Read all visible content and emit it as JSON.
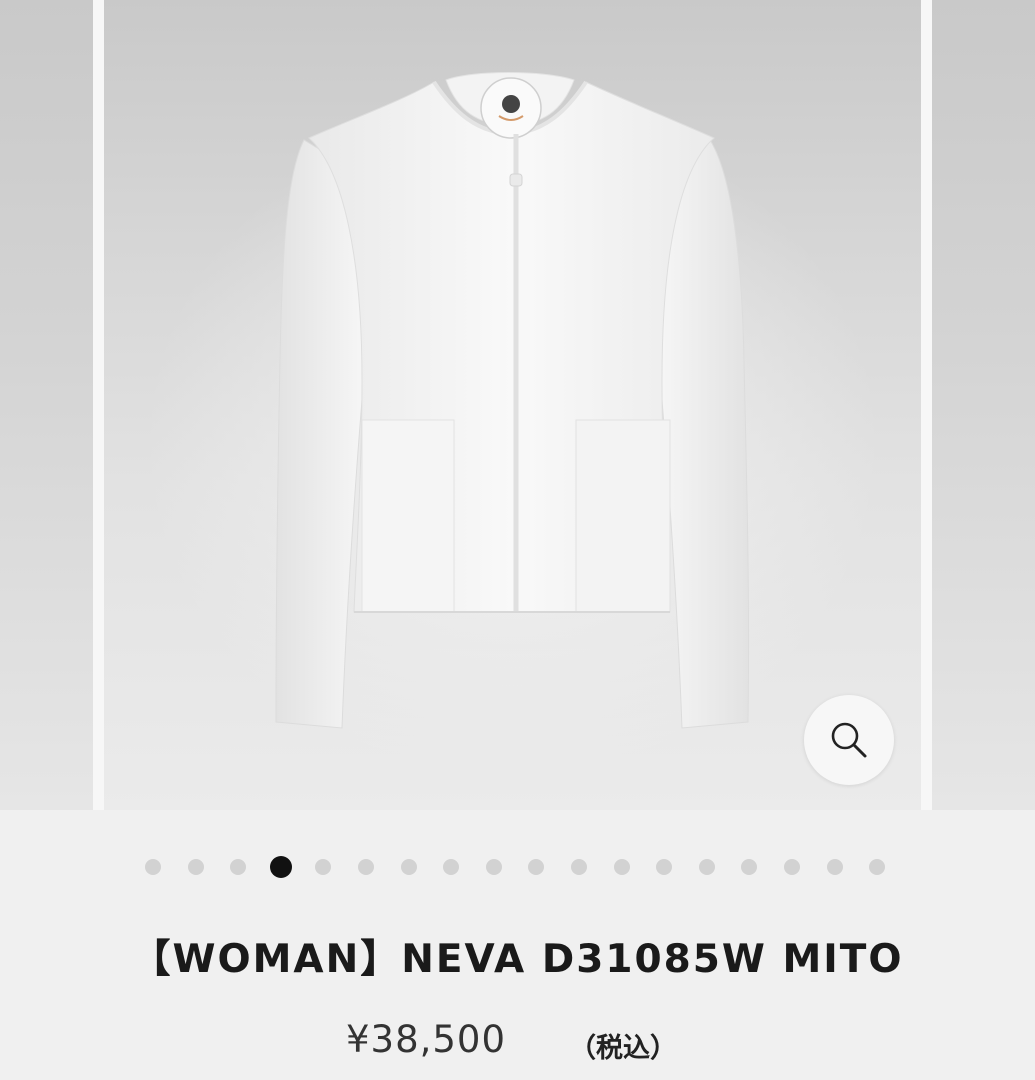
{
  "gallery": {
    "slide_count": 18,
    "active_index": 3,
    "zoom_icon": "magnifier-icon"
  },
  "product": {
    "title": "【WOMAN】NEVA D31085W MITO",
    "price": "¥38,500",
    "tax_note": "（税込）"
  },
  "colors": {
    "background": "#f0f0f0",
    "dot_inactive": "#d2d2d2",
    "dot_active": "#111111",
    "title_text": "#1a1a1a"
  }
}
